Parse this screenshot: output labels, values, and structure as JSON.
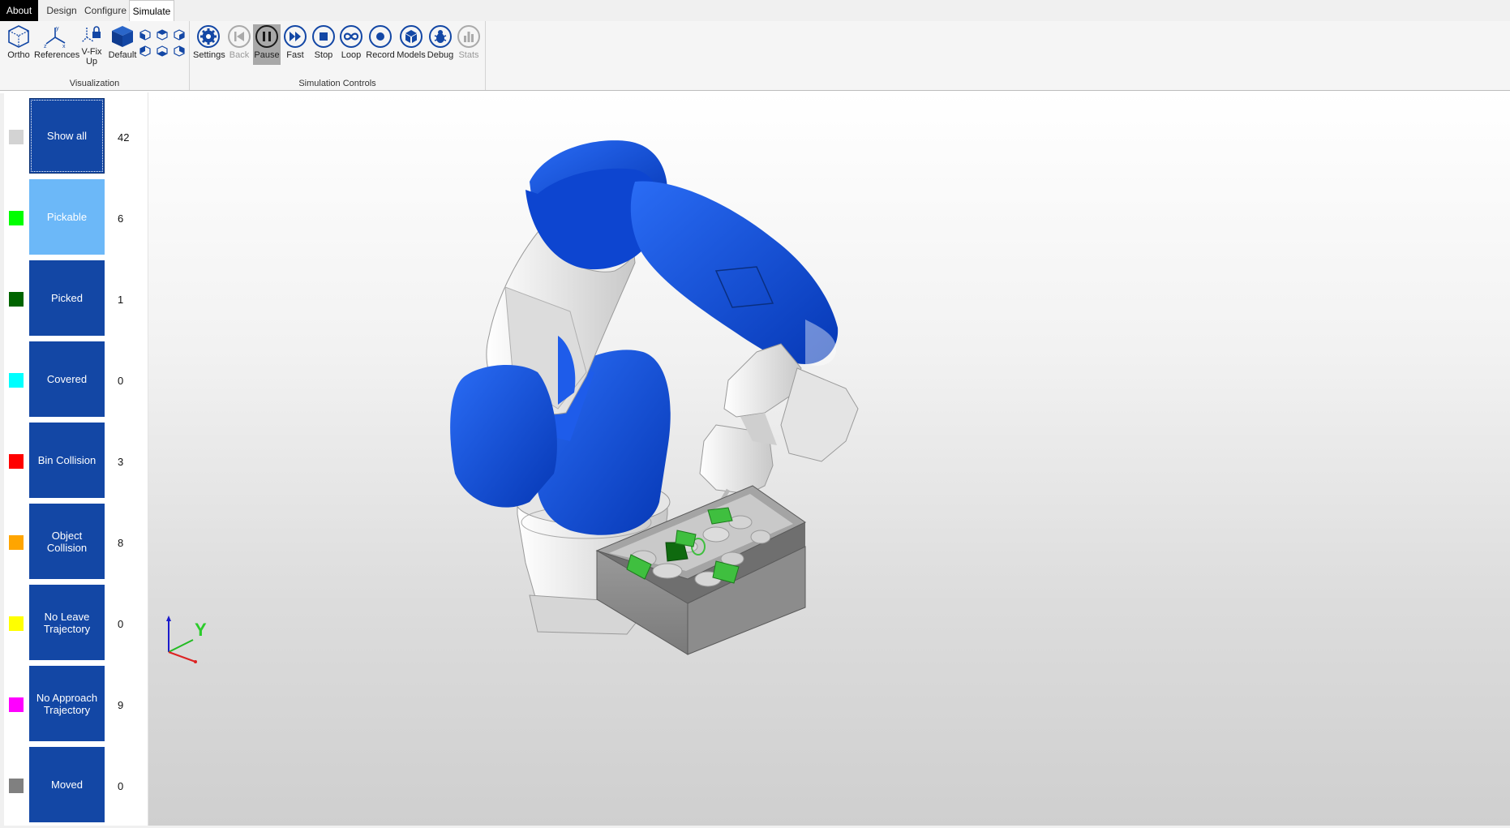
{
  "tabs": [
    {
      "label": "About"
    },
    {
      "label": "Design"
    },
    {
      "label": "Configure"
    },
    {
      "label": "Simulate"
    }
  ],
  "ribbon": {
    "visualization": {
      "group_label": "Visualization",
      "buttons": [
        {
          "label": "Ortho",
          "icon": "ortho-cube-icon"
        },
        {
          "label": "References",
          "icon": "axes-reference-icon"
        },
        {
          "label": "V-Fix\nUp",
          "icon": "vfix-lock-icon"
        },
        {
          "label": "Default",
          "icon": "default-cube-icon"
        }
      ],
      "view_cubes": [
        "view-front-icon",
        "view-top-icon",
        "view-right-icon",
        "view-back-icon",
        "view-bottom-icon",
        "view-left-icon"
      ]
    },
    "simulation": {
      "group_label": "Simulation Controls",
      "buttons": [
        {
          "label": "Settings",
          "icon": "gear-icon"
        },
        {
          "label": "Back",
          "icon": "skip-back-icon",
          "disabled": true
        },
        {
          "label": "Pause",
          "icon": "pause-icon",
          "pressed": true
        },
        {
          "label": "Fast",
          "icon": "fast-forward-icon"
        },
        {
          "label": "Stop",
          "icon": "stop-icon"
        },
        {
          "label": "Loop",
          "icon": "loop-icon"
        },
        {
          "label": "Record",
          "icon": "record-icon"
        },
        {
          "label": "Models",
          "icon": "models-cube-icon"
        },
        {
          "label": "Debug",
          "icon": "bug-icon"
        },
        {
          "label": "Stats",
          "icon": "stats-bars-icon",
          "disabled": true
        }
      ]
    }
  },
  "filters": [
    {
      "label": "Show all",
      "count": "42",
      "color": "#d3d3d3"
    },
    {
      "label": "Pickable",
      "count": "6",
      "color": "#00ff00"
    },
    {
      "label": "Picked",
      "count": "1",
      "color": "#006400"
    },
    {
      "label": "Covered",
      "count": "0",
      "color": "#00ffff"
    },
    {
      "label": "Bin Collision",
      "count": "3",
      "color": "#ff0000"
    },
    {
      "label": "Object Collision",
      "count": "8",
      "color": "#ffa500"
    },
    {
      "label": "No Leave\nTrajectory",
      "count": "0",
      "color": "#ffff00"
    },
    {
      "label": "No Approach\nTrajectory",
      "count": "9",
      "color": "#ff00ff"
    },
    {
      "label": "Moved",
      "count": "0",
      "color": "#808080"
    }
  ],
  "viewport": {
    "axis_label_y": "Y",
    "colors": {
      "robot_blue": "#0a4fe0",
      "robot_white": "#e8e8e8",
      "bin_gray": "#8a8a8a",
      "part_green": "#3fbf3f"
    }
  }
}
